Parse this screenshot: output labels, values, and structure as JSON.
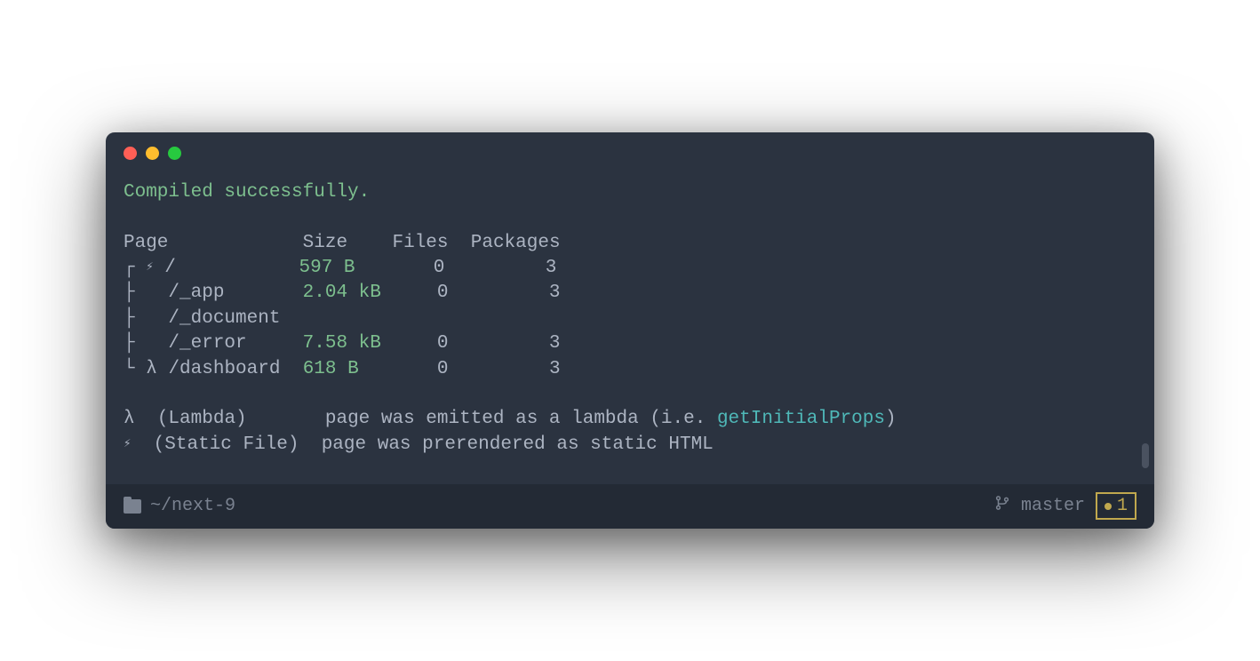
{
  "compile_status": "Compiled successfully.",
  "table": {
    "headers": {
      "page": "Page",
      "size": "Size",
      "files": "Files",
      "packages": "Packages"
    },
    "rows": [
      {
        "tree": "┌",
        "icon": "⚡",
        "path": "/",
        "size": "597 B",
        "files": "0",
        "packages": "3"
      },
      {
        "tree": "├",
        "icon": " ",
        "path": "/_app",
        "size": "2.04 kB",
        "files": "0",
        "packages": "3"
      },
      {
        "tree": "├",
        "icon": " ",
        "path": "/_document",
        "size": "",
        "files": "",
        "packages": ""
      },
      {
        "tree": "├",
        "icon": " ",
        "path": "/_error",
        "size": "7.58 kB",
        "files": "0",
        "packages": "3"
      },
      {
        "tree": "└",
        "icon": "λ",
        "path": "/dashboard",
        "size": "618 B",
        "files": "0",
        "packages": "3"
      }
    ]
  },
  "legend": {
    "lambda": {
      "symbol": "λ",
      "name": "(Lambda)",
      "desc_pre": "page was emitted as a lambda (i.e. ",
      "desc_highlight": "getInitialProps",
      "desc_post": ")"
    },
    "static": {
      "symbol": "⚡",
      "name": "(Static File)",
      "desc": "page was prerendered as static HTML"
    }
  },
  "status": {
    "cwd": "~/next-9",
    "branch": "master",
    "changes": "1"
  }
}
